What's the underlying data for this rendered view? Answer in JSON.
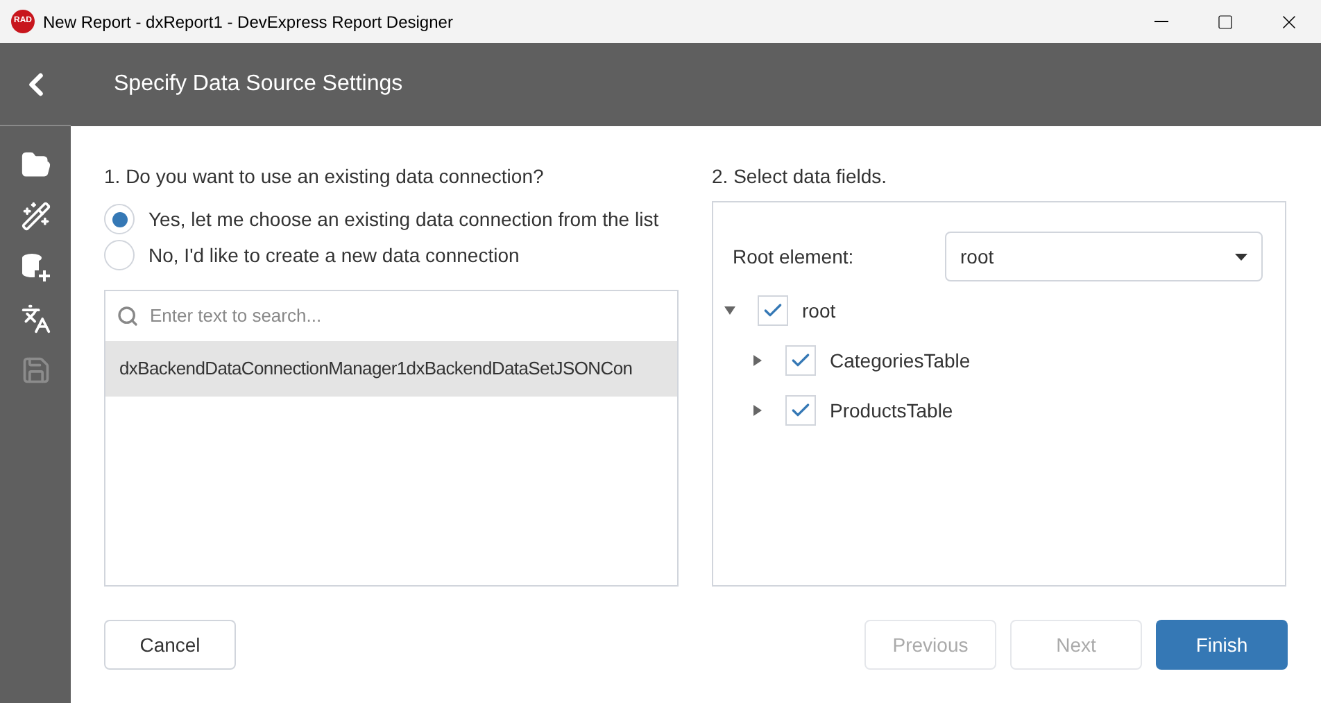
{
  "window": {
    "title": "New Report - dxReport1 - DevExpress Report Designer",
    "logo": "RAD"
  },
  "sidebar": {
    "items": [
      {
        "disabled": false
      },
      {
        "disabled": false
      },
      {
        "disabled": false
      },
      {
        "disabled": false
      },
      {
        "disabled": true
      }
    ]
  },
  "header": {
    "title": "Specify Data Source Settings"
  },
  "connection": {
    "question": "1. Do you want to use an existing data connection?",
    "options": [
      {
        "label": "Yes, let me choose an existing data connection from the list",
        "selected": true
      },
      {
        "label": "No, I'd like to create a new data connection",
        "selected": false
      }
    ],
    "search": {
      "placeholder": "Enter text to search..."
    },
    "items": [
      {
        "label": "dxBackendDataConnectionManager1dxBackendDataSetJSONCon",
        "selected": true
      }
    ]
  },
  "fields": {
    "title": "2. Select data fields.",
    "root_label": "Root element:",
    "root_value": "root",
    "tree": [
      {
        "label": "root",
        "checked": true,
        "expanded": true,
        "children": [
          {
            "label": "CategoriesTable",
            "checked": true,
            "expanded": false
          },
          {
            "label": "ProductsTable",
            "checked": true,
            "expanded": false
          }
        ]
      }
    ]
  },
  "buttons": [
    {
      "label": "Cancel",
      "kind": "plain",
      "disabled": false
    },
    {
      "label": "Previous",
      "kind": "plain",
      "disabled": true
    },
    {
      "label": "Next",
      "kind": "plain",
      "disabled": true
    },
    {
      "label": "Finish",
      "kind": "primary",
      "disabled": false
    }
  ]
}
